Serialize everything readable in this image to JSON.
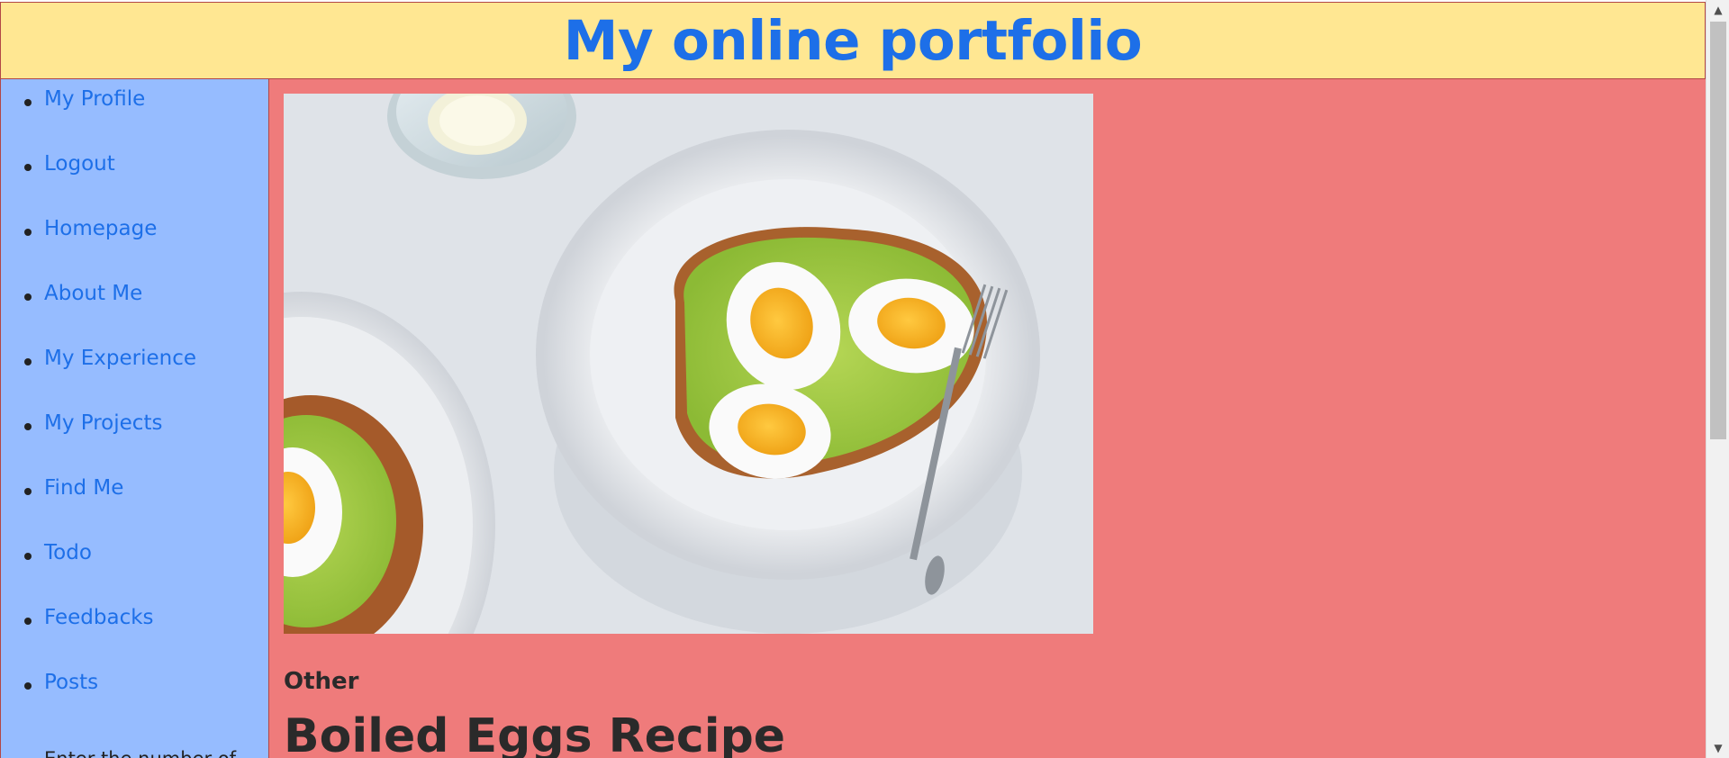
{
  "header": {
    "title": "My online portfolio"
  },
  "sidebar": {
    "items": [
      {
        "label": "My Profile"
      },
      {
        "label": "Logout"
      },
      {
        "label": "Homepage"
      },
      {
        "label": "About Me"
      },
      {
        "label": "My Experience"
      },
      {
        "label": "My Projects"
      },
      {
        "label": "Find Me"
      },
      {
        "label": "Todo"
      },
      {
        "label": "Feedbacks"
      },
      {
        "label": "Posts"
      }
    ],
    "counter_text": "Enter the number of"
  },
  "main": {
    "image_icon": "photo-avocado-toast-eggs-icon",
    "category": "Other",
    "post_title": "Boiled Eggs Recipe"
  },
  "colors": {
    "header_bg": "#ffe792",
    "title_color": "#1d6fe8",
    "sidebar_bg": "#96bcff",
    "main_bg": "#ef7b7b",
    "border": "#b24747"
  }
}
